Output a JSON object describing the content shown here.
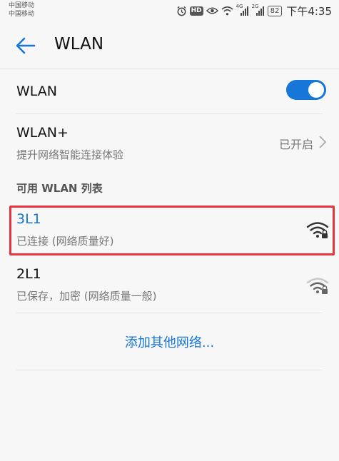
{
  "status_bar": {
    "carrier_1": "中国移动",
    "carrier_2": "中国移动",
    "hd_label": "HD",
    "net_1": "4G",
    "net_2": "2G",
    "battery": "82",
    "time": "下午4:35",
    "icons": [
      "alarm-icon",
      "eye-icon",
      "wifi-icon",
      "signal-icon",
      "signal-icon"
    ]
  },
  "header": {
    "title": "WLAN",
    "back_icon": "arrow-left-icon"
  },
  "wlan_toggle": {
    "label": "WLAN",
    "enabled": true
  },
  "wlan_plus": {
    "label": "WLAN+",
    "subtitle": "提升网络智能连接体验",
    "value": "已开启"
  },
  "section": {
    "title": "可用 WLAN 列表"
  },
  "networks": [
    {
      "name": "3L1",
      "status": "已连接 (网络质量好)",
      "signal": "strong",
      "locked": true,
      "connected": true
    },
    {
      "name": "2L1",
      "status": "已保存，加密 (网络质量一般)",
      "signal": "medium",
      "locked": true,
      "connected": false
    }
  ],
  "add_network": {
    "label": "添加其他网络..."
  },
  "colors": {
    "accent": "#1677d8",
    "highlight": "#e8333d",
    "background": "#f7f7f7"
  }
}
